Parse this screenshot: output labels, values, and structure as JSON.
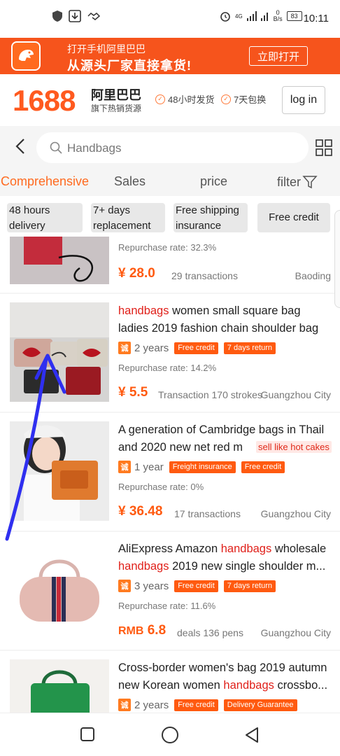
{
  "statusbar": {
    "time": "10:11",
    "battery": "83",
    "network": "4G",
    "speed_top": "0",
    "speed_unit": "B/s"
  },
  "banner": {
    "line1": "打开手机阿里巴巴",
    "line2": "从源头厂家直接拿货!",
    "open_button": "立即打开",
    "logo_text": "1688",
    "bg_color": "#f6541c"
  },
  "header": {
    "brand_number": "1688",
    "brand_cn": "阿里巴巴",
    "brand_sub": "旗下热销货源",
    "badge1": "48小时发货",
    "badge2": "7天包换",
    "login_label": "log in",
    "accent_color": "#ff6a1f"
  },
  "search": {
    "placeholder": "Handbags",
    "back_icon": "chevron-left-icon",
    "grid_icon": "grid-icon"
  },
  "tabs": {
    "comprehensive": "Comprehensive",
    "sales": "Sales",
    "price": "price",
    "filter": "filter"
  },
  "filters": {
    "chip1": "48 hours delivery",
    "chip2": "7+ days replacement",
    "chip3": "Free shipping insurance",
    "chip4": "Free credit"
  },
  "items": [
    {
      "rate": "Repurchase rate: 32.3%",
      "currency": "¥",
      "price": "28.0",
      "transactions": "29 transactions",
      "location": "Baoding"
    },
    {
      "title_hl": "handbags",
      "title_rest": " women small square bag ladies 2019 fashion chain shoulder bag m...",
      "chengxin": "诚",
      "years": "2 years",
      "tag1": "Free credit",
      "tag2": "7 days return",
      "rate": "Repurchase rate: 14.2%",
      "currency": "¥",
      "price": "5.5",
      "transactions": "Transaction 170 strokes",
      "location": "Guangzhou City"
    },
    {
      "title_text": "A generation of Cambridge bags in Thail and 2020 new net red m",
      "pink_tag": "sell like hot cakes",
      "chengxin": "诚",
      "years": "1 year",
      "tag1": "Freight insurance",
      "tag2": "Free credit",
      "rate": "Repurchase rate: 0%",
      "currency": "¥",
      "price": "36.48",
      "transactions": "17 transactions",
      "location": "Guangzhou City"
    },
    {
      "title_a": "AliExpress Amazon ",
      "title_hl1": "handbags",
      "title_b": " wholesale ",
      "title_hl2": "handbags",
      "title_c": " 2019 new single shoulder m...",
      "chengxin": "诚",
      "years": "3 years",
      "tag1": "Free credit",
      "tag2": "7 days return",
      "rate": "Repurchase rate: 11.6%",
      "currency": "RMB",
      "price": "6.8",
      "transactions": "deals 136 pens",
      "location": "Guangzhou City"
    },
    {
      "title_a": "Cross-border women's bag 2019 autumn new Korean women ",
      "title_hl": "handbags",
      "title_b": " crossbo...",
      "chengxin": "诚",
      "years": "2 years",
      "tag1": "Free credit",
      "tag2": "Delivery Guarantee"
    }
  ],
  "navbar": {
    "square_icon": "recent-apps-icon",
    "circle_icon": "home-icon",
    "triangle_icon": "back-icon"
  }
}
